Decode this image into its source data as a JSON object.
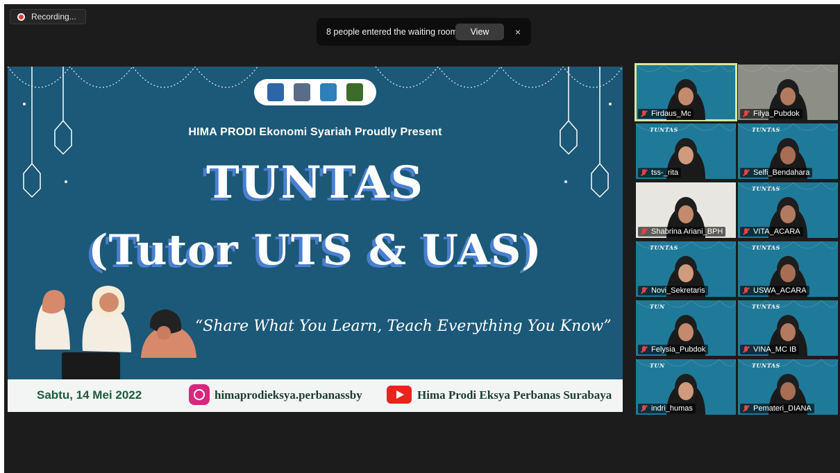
{
  "recording": {
    "label": "Recording..."
  },
  "notification": {
    "text": "8 people entered the waiting room",
    "view_label": "View",
    "close_label": "×"
  },
  "slide": {
    "present_line": "HIMA PRODI Ekonomi Syariah Proudly Present",
    "title_main": "TUNTAS",
    "title_sub": "(Tutor UTS & UAS)",
    "tagline": "“Share What You Learn, Teach Everything You Know”",
    "date": "Sabtu, 14 Mei 2022",
    "instagram": "himaprodieksya.perbanassby",
    "youtube": "Hima Prodi Eksya Perbanas Surabaya",
    "logos": [
      "university-logo",
      "hima-logo",
      "fossei-logo",
      "mosque-logo"
    ]
  },
  "participants": [
    {
      "name": "Firdaus_Mc",
      "active": true,
      "muted": true,
      "slide_text": ""
    },
    {
      "name": "Filya_Pubdok",
      "active": false,
      "muted": true,
      "slide_text": ""
    },
    {
      "name": "tss-_rita",
      "active": false,
      "muted": true,
      "slide_text": "TUNTAS"
    },
    {
      "name": "Selfi_Bendahara",
      "active": false,
      "muted": true,
      "slide_text": "TUNTAS"
    },
    {
      "name": "Shabrina Ariani_BPH",
      "active": false,
      "muted": true,
      "slide_text": ""
    },
    {
      "name": "VITA_ACARA",
      "active": false,
      "muted": true,
      "slide_text": "TUNTAS"
    },
    {
      "name": "Novi_Sekretaris",
      "active": false,
      "muted": true,
      "slide_text": "TUNTAS"
    },
    {
      "name": "USWA_ACARA",
      "active": false,
      "muted": true,
      "slide_text": "TUNTAS"
    },
    {
      "name": "Felysia_Pubdok",
      "active": false,
      "muted": true,
      "slide_text": "TUN"
    },
    {
      "name": "VINA_MC IB",
      "active": false,
      "muted": true,
      "slide_text": "TUNTAS"
    },
    {
      "name": "indri_humas",
      "active": false,
      "muted": true,
      "slide_text": "TUN"
    },
    {
      "name": "Pemateri_DIANA",
      "active": false,
      "muted": true,
      "slide_text": "TUNTAS"
    }
  ],
  "colors": {
    "slide_bg": "#1c5877",
    "active_border": "#d8e89a",
    "window_bg": "#1c1c1c"
  }
}
